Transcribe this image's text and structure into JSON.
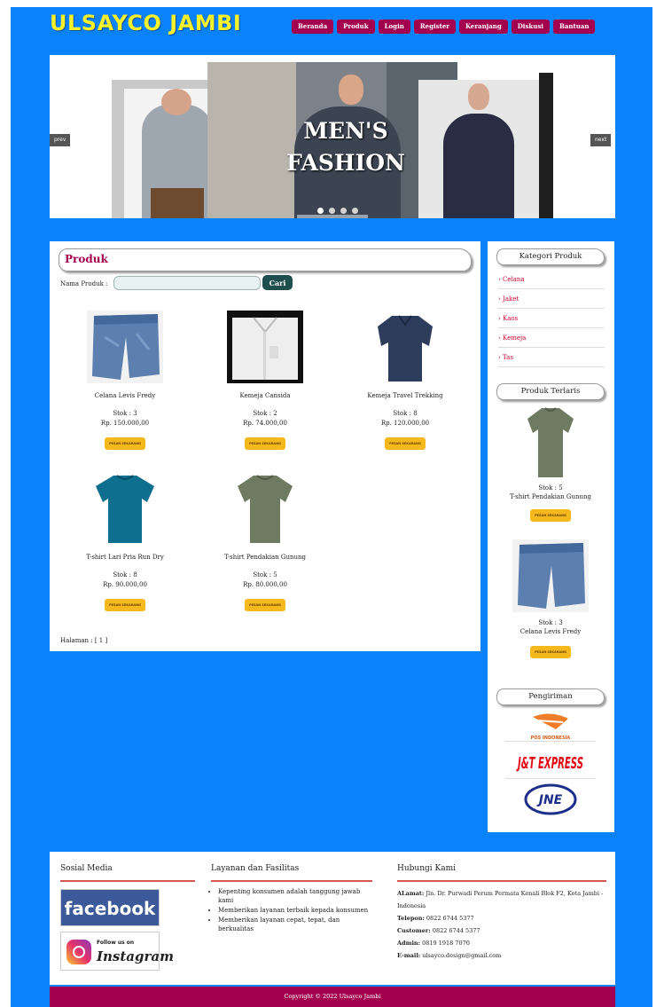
{
  "site": {
    "title": "ULSAYCO JAMBI"
  },
  "nav": [
    {
      "label": "Beranda"
    },
    {
      "label": "Produk"
    },
    {
      "label": "Login"
    },
    {
      "label": "Register"
    },
    {
      "label": "Keranjang"
    },
    {
      "label": "Diskusi"
    },
    {
      "label": "Bantuan"
    }
  ],
  "banner": {
    "title": "MEN'S FASHION",
    "prev": "prev",
    "next": "next"
  },
  "main": {
    "heading": "Produk",
    "search_label": "Nama Produk :",
    "search_value": "",
    "search_button": "Cari",
    "order_label": "PESAN SEKARANG",
    "pager": "Halaman : [ 1 ]",
    "products": [
      {
        "name": "Celana Levis Fredy",
        "stock": "Stok : 3",
        "price": "Rp. 150.000,00",
        "image": "jeans-shorts"
      },
      {
        "name": "Kemeja Cansida",
        "stock": "Stok : 2",
        "price": "Rp. 74.000,00",
        "image": "white-shirt"
      },
      {
        "name": "Kemeja Travel Trekking",
        "stock": "Stok : 8",
        "price": "Rp. 120.000,00",
        "image": "navy-shirt"
      },
      {
        "name": "T-shirt Lari Pria Run Dry",
        "stock": "Stok : 8",
        "price": "Rp. 90.000,00",
        "image": "teal-tshirt"
      },
      {
        "name": "T-shirt Pendakian Gunung",
        "stock": "Stok : 5",
        "price": "Rp. 80.000,00",
        "image": "olive-tshirt"
      }
    ]
  },
  "sidebar": {
    "category_heading": "Kategori Produk",
    "categories": [
      {
        "label": "› Celana"
      },
      {
        "label": "› Jaket"
      },
      {
        "label": "› Kaos"
      },
      {
        "label": "› Kemeja"
      },
      {
        "label": "› Tas"
      }
    ],
    "best_heading": "Produk Terlaris",
    "best": [
      {
        "stock": "Stok : 5",
        "name": "T-shirt Pendakian Gunung",
        "image": "olive-tshirt"
      },
      {
        "stock": "Stok : 3",
        "name": "Celana Levis Fredy",
        "image": "jeans-shorts"
      }
    ],
    "shipping_heading": "Pengiriman",
    "shipping": [
      {
        "name": "POS INDONESIA"
      },
      {
        "name": "J&T EXPRESS"
      },
      {
        "name": "JNE"
      }
    ]
  },
  "footer": {
    "social_heading": "Sosial Media",
    "facebook": "facebook",
    "instagram_line1": "Follow us on",
    "instagram_line2": "Instagram",
    "services_heading": "Layanan dan Fasilitas",
    "services": [
      "Kepenting konsumen adalah tanggung jawab kami",
      "Memberikan layanan terbaik kepada konsumen",
      "Memberikan layanan cepat, tepat, dan berkualitas"
    ],
    "contact_heading": "Hubungi Kami",
    "contact": {
      "alamat_label": "ALamat:",
      "alamat": "Jln. Dr. Purwadi Perum Permata Kenali Blok F2, Kota Jambi - Indonesia",
      "telepon_label": "Telepon:",
      "telepon": "0822 6744 5377",
      "customer_label": "Customer:",
      "customer": "0822 6744 5377",
      "admin_label": "Admin:",
      "admin": "0819 1918 7070",
      "email_label": "E-mail:",
      "email": "ulsayco.design@gmail.com"
    },
    "copyright": "Copyright © 2022 Ulsayco Jambi"
  },
  "colors": {
    "background": "#0a82fa",
    "accent": "#a3004f",
    "title": "#f6f22c",
    "order_button": "#f5b91d"
  }
}
